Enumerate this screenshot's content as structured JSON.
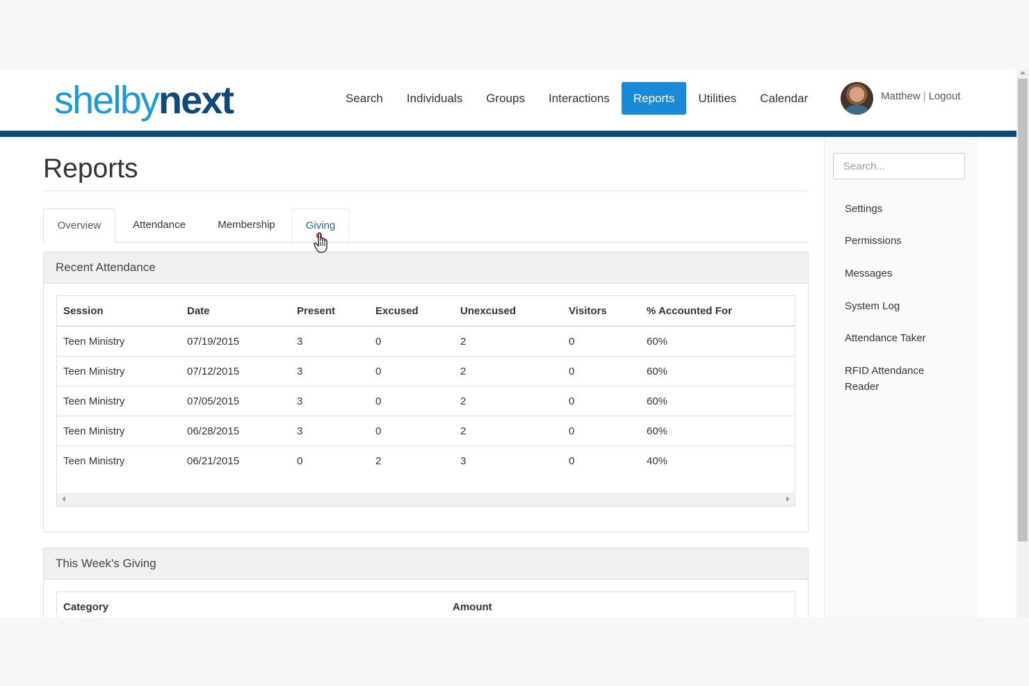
{
  "header": {
    "logo_part1": "shelby",
    "logo_part2": "next",
    "nav": [
      "Search",
      "Individuals",
      "Groups",
      "Interactions",
      "Reports",
      "Utilities",
      "Calendar"
    ],
    "active_nav": "Reports",
    "user_name": "Matthew",
    "separator": "|",
    "logout": "Logout"
  },
  "page": {
    "title": "Reports",
    "tabs": [
      "Overview",
      "Attendance",
      "Membership",
      "Giving"
    ],
    "active_tab": "Overview",
    "hovered_tab": "Giving"
  },
  "recent_attendance": {
    "title": "Recent Attendance",
    "columns": [
      "Session",
      "Date",
      "Present",
      "Excused",
      "Unexcused",
      "Visitors",
      "% Accounted For"
    ],
    "rows": [
      [
        "Teen Ministry",
        "07/19/2015",
        "3",
        "0",
        "2",
        "0",
        "60%"
      ],
      [
        "Teen Ministry",
        "07/12/2015",
        "3",
        "0",
        "2",
        "0",
        "60%"
      ],
      [
        "Teen Ministry",
        "07/05/2015",
        "3",
        "0",
        "2",
        "0",
        "60%"
      ],
      [
        "Teen Ministry",
        "06/28/2015",
        "3",
        "0",
        "2",
        "0",
        "60%"
      ],
      [
        "Teen Ministry",
        "06/21/2015",
        "0",
        "2",
        "3",
        "0",
        "40%"
      ]
    ]
  },
  "weekly_giving": {
    "title": "This Week's Giving",
    "columns": [
      "Category",
      "Amount"
    ]
  },
  "sidebar": {
    "search_placeholder": "Search...",
    "items": [
      "Settings",
      "Permissions",
      "Messages",
      "System Log",
      "Attendance Taker",
      "RFID Attendance Reader"
    ]
  },
  "colors": {
    "brand_blue": "#1a9ad6",
    "brand_navy": "#0c4a7a",
    "active_nav_bg": "#1a8ad8"
  }
}
